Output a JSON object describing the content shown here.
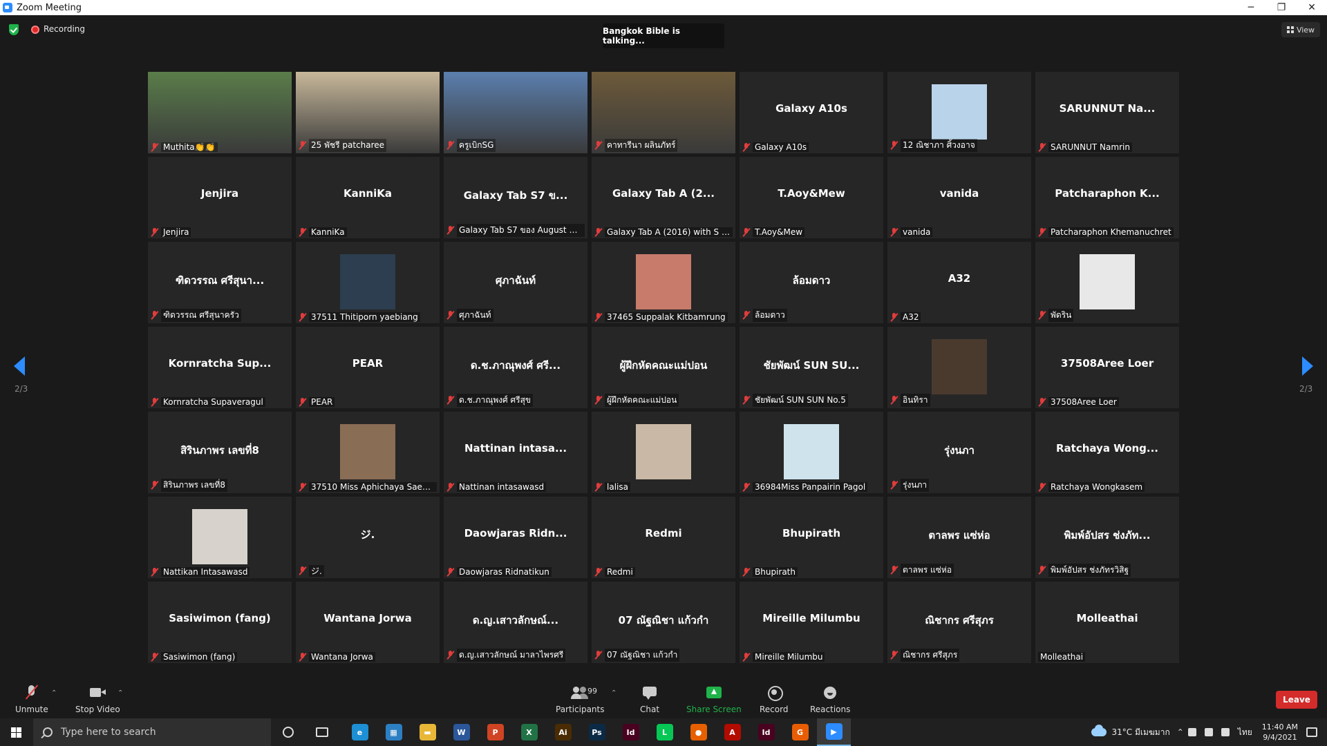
{
  "window": {
    "title": "Zoom Meeting",
    "minimize": "─",
    "restore": "❐",
    "close": "✕"
  },
  "topbar": {
    "recording_label": "Recording",
    "talking": "Bangkok Bible is talking...",
    "view_label": "View"
  },
  "colors": {
    "accent": "#2d8cff",
    "mic_off": "#e23c3c",
    "share_green": "#1fb34a",
    "leave_red": "#d42b2b",
    "tile_bg": "#262626"
  },
  "tiles": [
    {
      "name": "Muthita👏👏",
      "big": "",
      "avatar_color": "#5a7d4a",
      "kind": "video"
    },
    {
      "name": "25 พัชรี patcharee",
      "big": "",
      "avatar_color": "#c8b89a",
      "kind": "video"
    },
    {
      "name": "ครูเบิกSG",
      "big": "",
      "avatar_color": "#5b7fae",
      "kind": "video"
    },
    {
      "name": "คาทารีนา ผลินภัทร์",
      "big": "",
      "avatar_color": "#6d5a3a",
      "kind": "video"
    },
    {
      "name": "Galaxy A10s",
      "big": "Galaxy A10s",
      "kind": "text"
    },
    {
      "name": "12 ณิชาภา ศิ้วงอาจ",
      "big": "",
      "avatar_color": "#b9d3ea",
      "kind": "photo"
    },
    {
      "name": "SARUNNUT Namrin",
      "big": "SARUNNUT Na...",
      "kind": "text"
    },
    {
      "name": "Jenjira",
      "big": "Jenjira",
      "kind": "text"
    },
    {
      "name": "KanniKa",
      "big": "KanniKa",
      "kind": "text"
    },
    {
      "name": "Galaxy Tab S7 ของ August Ho...",
      "big": "Galaxy Tab S7 ข...",
      "kind": "text"
    },
    {
      "name": "Galaxy Tab A (2016) with S Pen",
      "big": "Galaxy Tab A (2...",
      "kind": "text"
    },
    {
      "name": "T.Aoy&Mew",
      "big": "T.Aoy&Mew",
      "kind": "text"
    },
    {
      "name": "vanida",
      "big": "vanida",
      "kind": "text"
    },
    {
      "name": "Patcharaphon Khemanuchret",
      "big": "Patcharaphon K...",
      "kind": "text"
    },
    {
      "name": "ฑิดวรรณ ศรีสุนาครัว",
      "big": "ฑิดวรรณ ศรีสุนา...",
      "kind": "text"
    },
    {
      "name": "37511 Thitiporn yaebiang",
      "big": "",
      "avatar_color": "#2c3e50",
      "kind": "photo"
    },
    {
      "name": "ศุภาฉันท์",
      "big": "ศุภาฉันท์",
      "kind": "text"
    },
    {
      "name": "37465 Suppalak Kitbamrung",
      "big": "",
      "avatar_color": "#c97b6b",
      "kind": "photo"
    },
    {
      "name": "ล้อมดาว",
      "big": "ล้อมดาว",
      "kind": "text"
    },
    {
      "name": "A32",
      "big": "A32",
      "kind": "text"
    },
    {
      "name": "พัดริน",
      "big": "",
      "avatar_color": "#e8e8e8",
      "kind": "photo"
    },
    {
      "name": "Kornratcha Supaveragul",
      "big": "Kornratcha Sup...",
      "kind": "text"
    },
    {
      "name": "PEAR",
      "big": "PEAR",
      "kind": "text"
    },
    {
      "name": "ด.ช.ภาณุพงศ์ ศรีสุข",
      "big": "ด.ช.ภาณุพงศ์ ศรี...",
      "kind": "text"
    },
    {
      "name": "ผู้ฝึกหัดคณะแม่ปอน",
      "big": "ผู้ฝึกหัดคณะแม่ปอน",
      "kind": "text"
    },
    {
      "name": "ชัยพัฒน์ SUN SUN No.5",
      "big": "ชัยพัฒน์ SUN SU...",
      "kind": "text"
    },
    {
      "name": "อินทิรา",
      "big": "",
      "avatar_color": "#4a3a2e",
      "kind": "photo"
    },
    {
      "name": "37508Aree Loer",
      "big": "37508Aree Loer",
      "kind": "text"
    },
    {
      "name": "สิรินภาพร เลขที่8",
      "big": "สิรินภาพร เลขที่8",
      "kind": "text"
    },
    {
      "name": "37510 Miss Aphichaya Saemue",
      "big": "",
      "avatar_color": "#8a6d55",
      "kind": "photo"
    },
    {
      "name": "Nattinan intasawasd",
      "big": "Nattinan intasa...",
      "kind": "text"
    },
    {
      "name": "lalisa",
      "big": "",
      "avatar_color": "#c9b8a6",
      "kind": "photo"
    },
    {
      "name": "36984Miss Panpairin Pagol",
      "big": "",
      "avatar_color": "#cfe3ec",
      "kind": "photo"
    },
    {
      "name": "รุ่งนภา",
      "big": "รุ่งนภา",
      "kind": "text"
    },
    {
      "name": "Ratchaya Wongkasem",
      "big": "Ratchaya Wong...",
      "kind": "text"
    },
    {
      "name": "Nattikan Intasawasd",
      "big": "",
      "avatar_color": "#d7d2cc",
      "kind": "photo"
    },
    {
      "name": "ジ.",
      "big": "ジ.",
      "kind": "text"
    },
    {
      "name": "Daowjaras Ridnatikun",
      "big": "Daowjaras Ridn...",
      "kind": "text"
    },
    {
      "name": "Redmi",
      "big": "Redmi",
      "kind": "text"
    },
    {
      "name": "Bhupirath",
      "big": "Bhupirath",
      "kind": "text"
    },
    {
      "name": "ตาลพร แซ่ห่อ",
      "big": "ตาลพร แซ่ห่อ",
      "kind": "text"
    },
    {
      "name": "พิมพ์อัปสร ช่งภัทรวิสิฐ",
      "big": "พิมพ์อัปสร ช่งภัท...",
      "kind": "text"
    },
    {
      "name": "Sasiwimon (fang)",
      "big": "Sasiwimon (fang)",
      "kind": "text"
    },
    {
      "name": "Wantana Jorwa",
      "big": "Wantana Jorwa",
      "kind": "text"
    },
    {
      "name": "ด.ญ.เสาวลักษณ์ มาลาไพรศรี",
      "big": "ด.ญ.เสาวลักษณ์...",
      "kind": "text"
    },
    {
      "name": "07 ณัฐณิชา แก้วกำ",
      "big": "07 ณัฐณิชา แก้วกำ",
      "kind": "text"
    },
    {
      "name": "Mireille Milumbu",
      "big": "Mireille Milumbu",
      "kind": "text"
    },
    {
      "name": "ณิชากร ศรีสุภร",
      "big": "ณิชากร ศรีสุภร",
      "kind": "text"
    },
    {
      "name": "Molleathai",
      "big": "Molleathai",
      "kind": "text",
      "unmuted": true
    }
  ],
  "pagination": {
    "left_label": "2/3",
    "right_label": "2/3"
  },
  "controls": {
    "unmute": "Unmute",
    "stop_video": "Stop Video",
    "participants": "Participants",
    "participant_count": "99",
    "chat": "Chat",
    "share_screen": "Share Screen",
    "record": "Record",
    "reactions": "Reactions",
    "leave": "Leave"
  },
  "taskbar": {
    "search_placeholder": "Type here to search",
    "apps": [
      {
        "icon": "edge-icon",
        "glyph": "e",
        "color": "#1d8fd4"
      },
      {
        "icon": "calculator-icon",
        "glyph": "▦",
        "color": "#2c7fc2"
      },
      {
        "icon": "file-explorer-icon",
        "glyph": "▬",
        "color": "#e8b737"
      },
      {
        "icon": "word-icon",
        "glyph": "W",
        "color": "#2b579a"
      },
      {
        "icon": "powerpoint-icon",
        "glyph": "P",
        "color": "#d04423"
      },
      {
        "icon": "excel-icon",
        "glyph": "X",
        "color": "#217346"
      },
      {
        "icon": "illustrator-icon",
        "glyph": "Ai",
        "color": "#4a2c04"
      },
      {
        "icon": "photoshop-icon",
        "glyph": "Ps",
        "color": "#0b2a46"
      },
      {
        "icon": "indesign-icon",
        "glyph": "Id",
        "color": "#49021f"
      },
      {
        "icon": "line-icon",
        "glyph": "L",
        "color": "#06c755"
      },
      {
        "icon": "firefox-icon",
        "glyph": "●",
        "color": "#e66000"
      },
      {
        "icon": "acrobat-icon",
        "glyph": "A",
        "color": "#b30b00"
      },
      {
        "icon": "indesign-2-icon",
        "glyph": "Id",
        "color": "#49021f"
      },
      {
        "icon": "grammarly-icon",
        "glyph": "G",
        "color": "#e85d04"
      },
      {
        "icon": "zoom-icon",
        "glyph": "▶",
        "color": "#2d8cff",
        "active": true
      }
    ],
    "weather": "31°C มีเมฆมาก",
    "language": "ไทย",
    "time": "11:40 AM",
    "date": "9/4/2021"
  }
}
